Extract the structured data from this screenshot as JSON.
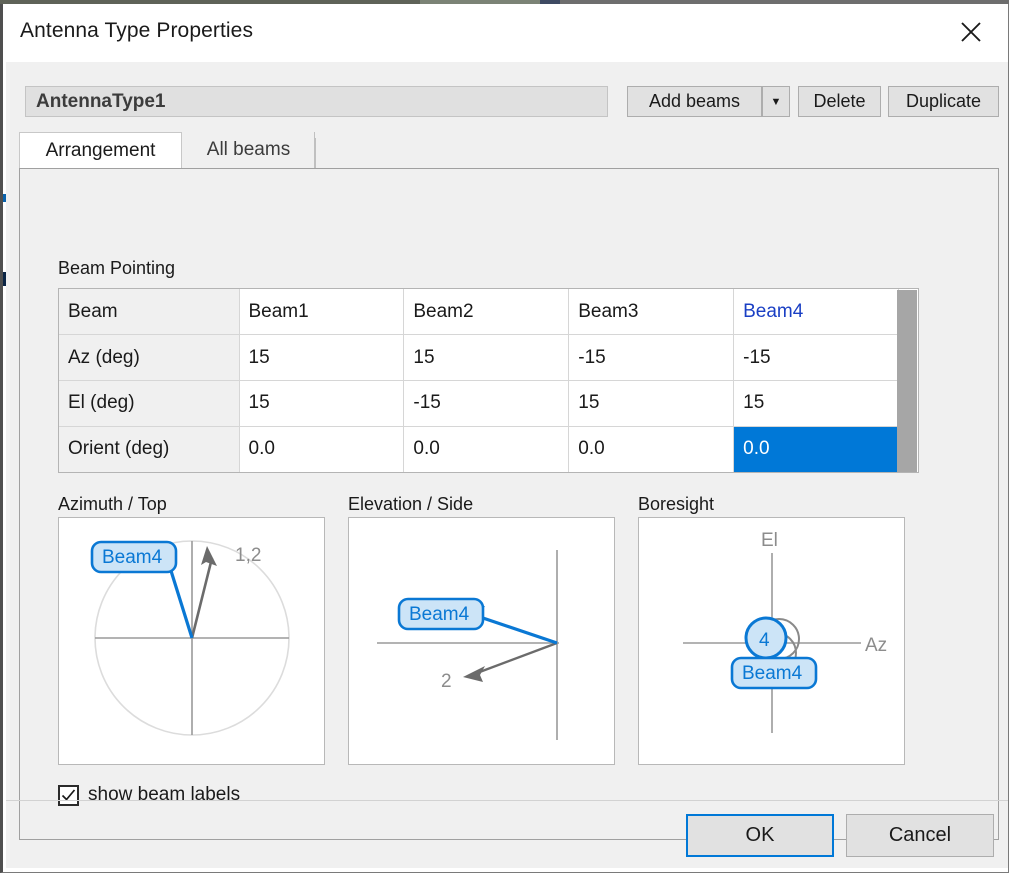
{
  "window": {
    "title": "Antenna Type Properties",
    "close_icon": "close-icon"
  },
  "toolbar": {
    "name_value": "AntennaType1",
    "add_beams_label": "Add beams",
    "add_beams_arrow": "▼",
    "delete_label": "Delete",
    "duplicate_label": "Duplicate"
  },
  "tabs": [
    {
      "label": "Arrangement",
      "selected": true
    },
    {
      "label": "All beams",
      "selected": false
    }
  ],
  "beam_pointing": {
    "group_label": "Beam Pointing",
    "row_headers": [
      "Beam",
      "Az (deg)",
      "El (deg)",
      "Orient (deg)"
    ],
    "columns": [
      "Beam1",
      "Beam2",
      "Beam3",
      "Beam4"
    ],
    "active_column": "Beam4",
    "rows": [
      {
        "header": "Az (deg)",
        "values": [
          "15",
          "15",
          "-15",
          "-15"
        ]
      },
      {
        "header": "El (deg)",
        "values": [
          "15",
          "-15",
          "15",
          "15"
        ]
      },
      {
        "header": "Orient (deg)",
        "values": [
          "0.0",
          "0.0",
          "0.0",
          "0.0"
        ]
      }
    ],
    "selected_cell": {
      "row": "Orient (deg)",
      "column": "Beam4",
      "value": "0.0"
    }
  },
  "diagrams": {
    "azimuth": {
      "title": "Azimuth / Top",
      "selected_label": "Beam4",
      "other_label": "1,2"
    },
    "elevation": {
      "title": "Elevation / Side",
      "selected_label": "Beam4",
      "other_label": "2"
    },
    "boresight": {
      "title": "Boresight",
      "axis_vertical_label": "El",
      "axis_horizontal_label": "Az",
      "marker_label": "4",
      "selected_label": "Beam4"
    }
  },
  "options": {
    "show_beam_labels_label": "show beam labels",
    "show_beam_labels_checked": true
  },
  "footer": {
    "ok_label": "OK",
    "cancel_label": "Cancel"
  },
  "colors": {
    "accent": "#0078d7",
    "label_fill": "#cce4f7",
    "gray_stroke": "#7a7a7a",
    "selected_header_text": "#1a3fc4"
  }
}
